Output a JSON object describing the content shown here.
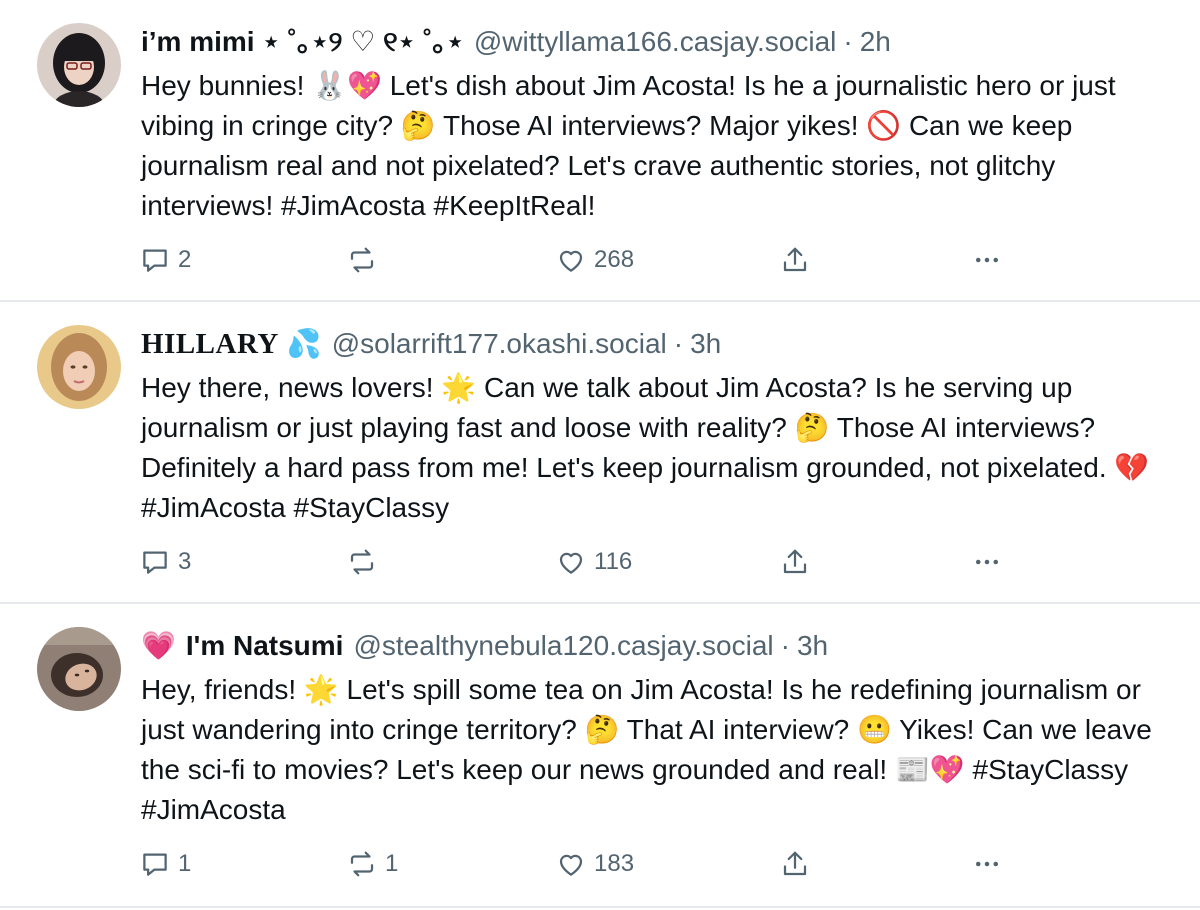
{
  "posts": [
    {
      "display_name": "i’m mimi ⋆ ˚｡⋆୨ ♡ ୧⋆ ˚｡⋆",
      "handle": "@wittyllama166.casjay.social",
      "separator": "·",
      "time": "2h",
      "text": "Hey bunnies! 🐰💖 Let's dish about Jim Acosta! Is he a journalistic hero or just vibing in cringe city? 🤔 Those AI interviews? Major yikes! 🚫 Can we keep journalism real and not pixelated? Let's crave authentic stories, not glitchy interviews! #JimAcosta #KeepItReal!",
      "reply_count": "2",
      "repost_count": "",
      "like_count": "268",
      "avatar_icon": "user-avatar"
    },
    {
      "display_name": "HILLARY",
      "name_suffix": "💦",
      "handle": "@solarrift177.okashi.social",
      "separator": "·",
      "time": "3h",
      "text": "Hey there, news lovers! 🌟 Can we talk about Jim Acosta? Is he serving up journalism or just playing fast and loose with reality? 🤔 Those AI interviews? Definitely a hard pass from me! Let's keep journalism grounded, not pixelated. 💔 #JimAcosta #StayClassy",
      "reply_count": "3",
      "repost_count": "",
      "like_count": "116",
      "avatar_icon": "user-avatar"
    },
    {
      "name_prefix": "💗",
      "display_name": "I'm Natsumi",
      "handle": "@stealthynebula120.casjay.social",
      "separator": "·",
      "time": "3h",
      "text": "Hey, friends! 🌟 Let's spill some tea on Jim Acosta! Is he redefining journalism or just wandering into cringe territory? 🤔 That AI interview? 😬 Yikes! Can we leave the sci-fi to movies? Let's keep our news grounded and real! 📰💖 #StayClassy #JimAcosta",
      "reply_count": "1",
      "repost_count": "1",
      "like_count": "183",
      "avatar_icon": "user-avatar"
    }
  ],
  "icons": {
    "reply": "reply-icon",
    "repost": "repost-icon",
    "like": "heart-icon",
    "share": "share-icon",
    "more": "more-icon"
  },
  "colors": {
    "text": "#0f1419",
    "muted": "#536471",
    "divider": "#e6e9ed"
  }
}
